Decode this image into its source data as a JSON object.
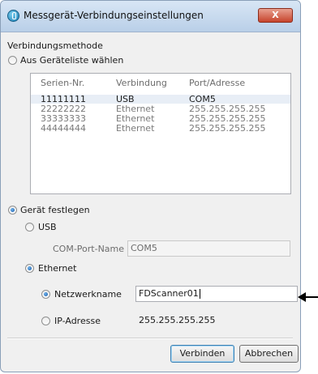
{
  "window": {
    "title": "Messgerät-Verbindungseinstellungen",
    "close_label": "X"
  },
  "connection_method": {
    "group_label": "Verbindungsmethode",
    "from_list_label": "Aus Geräteliste wählen"
  },
  "device_list": {
    "columns": [
      "Serien-Nr.",
      "Verbindung",
      "Port/Adresse"
    ],
    "rows": [
      {
        "serial": "11111111",
        "connection": "USB",
        "port": "COM5"
      },
      {
        "serial": "22222222",
        "connection": "Ethernet",
        "port": "255.255.255.255"
      },
      {
        "serial": "33333333",
        "connection": "Ethernet",
        "port": "255.255.255.255"
      },
      {
        "serial": "44444444",
        "connection": "Ethernet",
        "port": "255.255.255.255"
      }
    ]
  },
  "specify_device": {
    "label": "Gerät festlegen",
    "usb_label": "USB",
    "com_port_label": "COM-Port-Name",
    "com_port_value": "COM5",
    "ethernet_label": "Ethernet",
    "network_name_label": "Netzwerkname",
    "network_name_value": "FDScanner01",
    "ip_label": "IP-Adresse",
    "ip_value": "255.255.255.255"
  },
  "buttons": {
    "connect": "Verbinden",
    "cancel": "Abbrechen"
  },
  "colors": {
    "accent": "#1a5aa6",
    "close_button": "#c7442c"
  }
}
